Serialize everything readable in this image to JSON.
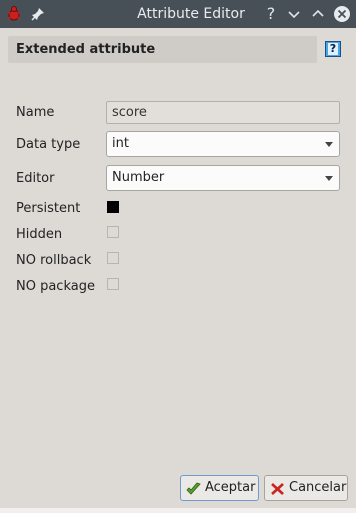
{
  "window": {
    "title": "Attribute Editor",
    "help_glyph": "?"
  },
  "section": {
    "title": "Extended attribute",
    "help_glyph": "?"
  },
  "form": {
    "name_label": "Name",
    "name_value": "score",
    "datatype_label": "Data type",
    "datatype_value": "int",
    "editor_label": "Editor",
    "editor_value": "Number",
    "persistent_label": "Persistent",
    "persistent_checked": true,
    "hidden_label": "Hidden",
    "hidden_checked": false,
    "norollback_label": "NO rollback",
    "norollback_checked": false,
    "nopackage_label": "NO package",
    "nopackage_checked": false
  },
  "buttons": {
    "ok_label": "Aceptar",
    "cancel_label": "Cancelar"
  },
  "colors": {
    "titlebar": "#475057",
    "background": "#dddad5",
    "help_icon": "#4aa3e6"
  },
  "icons": {
    "app": "red-bug-icon",
    "pin": "pin-icon",
    "ok": "green-check-icon",
    "cancel": "red-x-icon"
  }
}
